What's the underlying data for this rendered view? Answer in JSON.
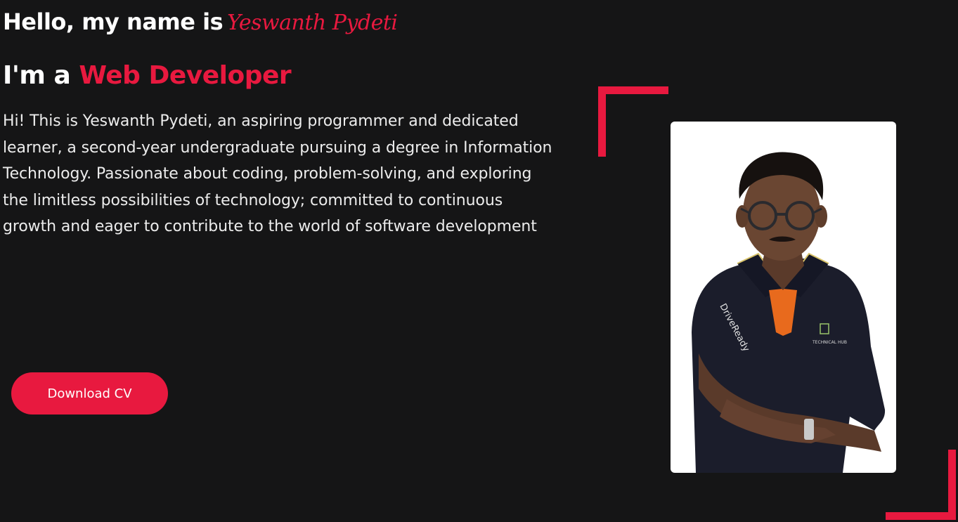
{
  "hero": {
    "greeting_prefix": "Hello, my name is",
    "name": "Yeswanth Pydeti",
    "role_prefix": "I'm a",
    "role": "Web Developer",
    "bio": "Hi! This is Yeswanth Pydeti, an aspiring programmer and dedicated learner, a second-year undergraduate pursuing a degree in Information Technology. Passionate about coding, problem-solving, and exploring the limitless possibilities of technology; committed to continuous growth and eager to contribute to the world of software development",
    "cv_button": "Download CV",
    "photo": {
      "shirt_text_1": "DriveReady",
      "shirt_text_2": "TECHNICAL HUB"
    }
  },
  "colors": {
    "background": "#151516",
    "accent": "#e8193f",
    "text": "#ffffff"
  }
}
